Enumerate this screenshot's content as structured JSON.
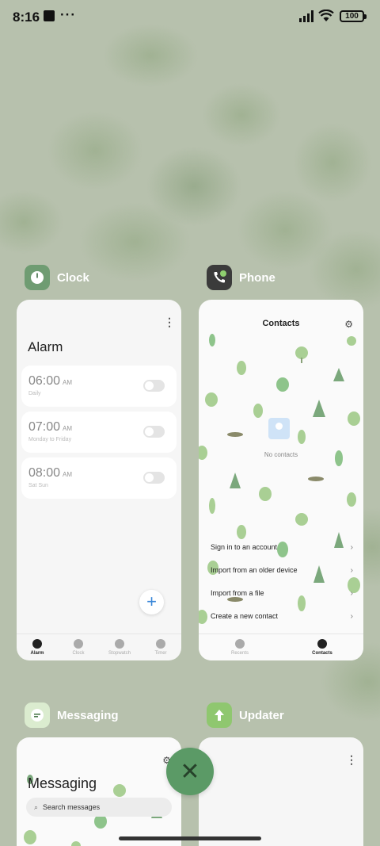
{
  "status_bar": {
    "time": "8:16",
    "battery": "100"
  },
  "cards": {
    "clock": {
      "app_name": "Clock",
      "title": "Alarm",
      "alarms": [
        {
          "time": "06:00",
          "ampm": "AM",
          "repeat": "Daily"
        },
        {
          "time": "07:00",
          "ampm": "AM",
          "repeat": "Monday to Friday"
        },
        {
          "time": "08:00",
          "ampm": "AM",
          "repeat": "Sat Sun"
        }
      ],
      "add_label": "+",
      "nav": [
        "Alarm",
        "Clock",
        "Stopwatch",
        "Timer"
      ]
    },
    "phone": {
      "app_name": "Phone",
      "title": "Contacts",
      "empty_text": "No contacts",
      "actions": [
        "Sign in to an account",
        "Import from an older device",
        "Import from a file",
        "Create a new contact"
      ],
      "nav": [
        "Recents",
        "Contacts"
      ]
    },
    "messaging": {
      "app_name": "Messaging",
      "title": "Messaging",
      "search_placeholder": "Search messages"
    },
    "updater": {
      "app_name": "Updater"
    }
  },
  "close_label": "✕",
  "icons": {
    "status": [
      "square-icon",
      "more-dots-icon",
      "signal-icon",
      "wifi-icon",
      "battery-icon"
    ],
    "accent": "#5b9a66"
  }
}
